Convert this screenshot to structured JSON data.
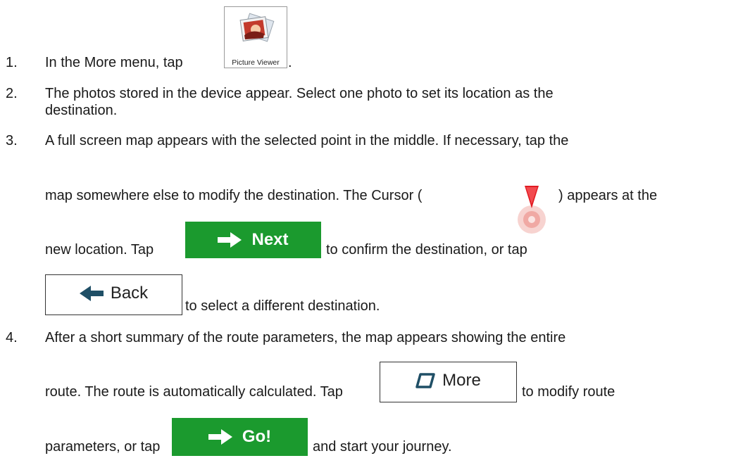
{
  "steps": [
    {
      "number": "1.",
      "text_before": "In the More menu, tap",
      "text_after": "."
    },
    {
      "number": "2.",
      "line1": "The photos stored in the device appear. Select one photo to set its location as the",
      "line2": "destination."
    },
    {
      "number": "3.",
      "line1": "A full screen map appears with the selected point in the middle. If necessary, tap the",
      "line2_before": "map somewhere else to modify the destination. The Cursor (",
      "line2_after": ") appears at the",
      "line3_before": "new location. Tap",
      "line3_after": "to confirm the destination, or tap",
      "line4_after": "to select a different destination."
    },
    {
      "number": "4.",
      "line1": "After a short summary of the route parameters, the map appears showing the entire",
      "line2_before": "route. The route is automatically calculated. Tap",
      "line2_after": "to modify route",
      "line3_before": "parameters, or tap",
      "line3_after": "and start your journey."
    }
  ],
  "buttons": {
    "picture_viewer": "Picture Viewer",
    "next": "Next",
    "back": "Back",
    "more": "More",
    "go": "Go!"
  },
  "colors": {
    "green_button": "#1b9a2e",
    "arrow_dark": "#1f4f66",
    "cursor_red": "#e11b22"
  }
}
